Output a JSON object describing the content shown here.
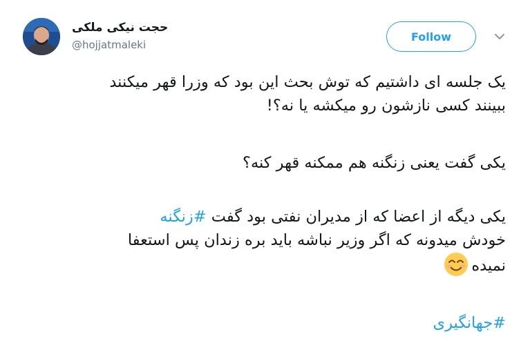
{
  "user": {
    "display_name": "حجت نیکی ملکی",
    "handle": "@hojjatmaleki"
  },
  "actions": {
    "follow_label": "Follow",
    "menu_icon": "chevron-down-icon"
  },
  "tweet": {
    "line1": "یک جلسه ای داشتیم که توش بحث این بود که وزرا قهر میکنند",
    "line2": "ببینند کسی نازشون رو میکشه یا نه؟!",
    "line3": "یکی گفت یعنی زنگنه هم ممکنه قهر کنه؟",
    "line4_text": "یکی دیگه از اعضا که از مدیران نفتی بود گفت ",
    "line4_hashtag": "#زنگنه",
    "line5": "خودش میدونه که اگر وزیر نباشه باید بره زندان پس استعفا",
    "line6": "نمیده",
    "emoji": "smiling-face-icon",
    "final_hashtag": "#جهانگیری"
  },
  "colors": {
    "accent": "#1da1f2",
    "text": "#14171a",
    "secondary": "#657786"
  }
}
